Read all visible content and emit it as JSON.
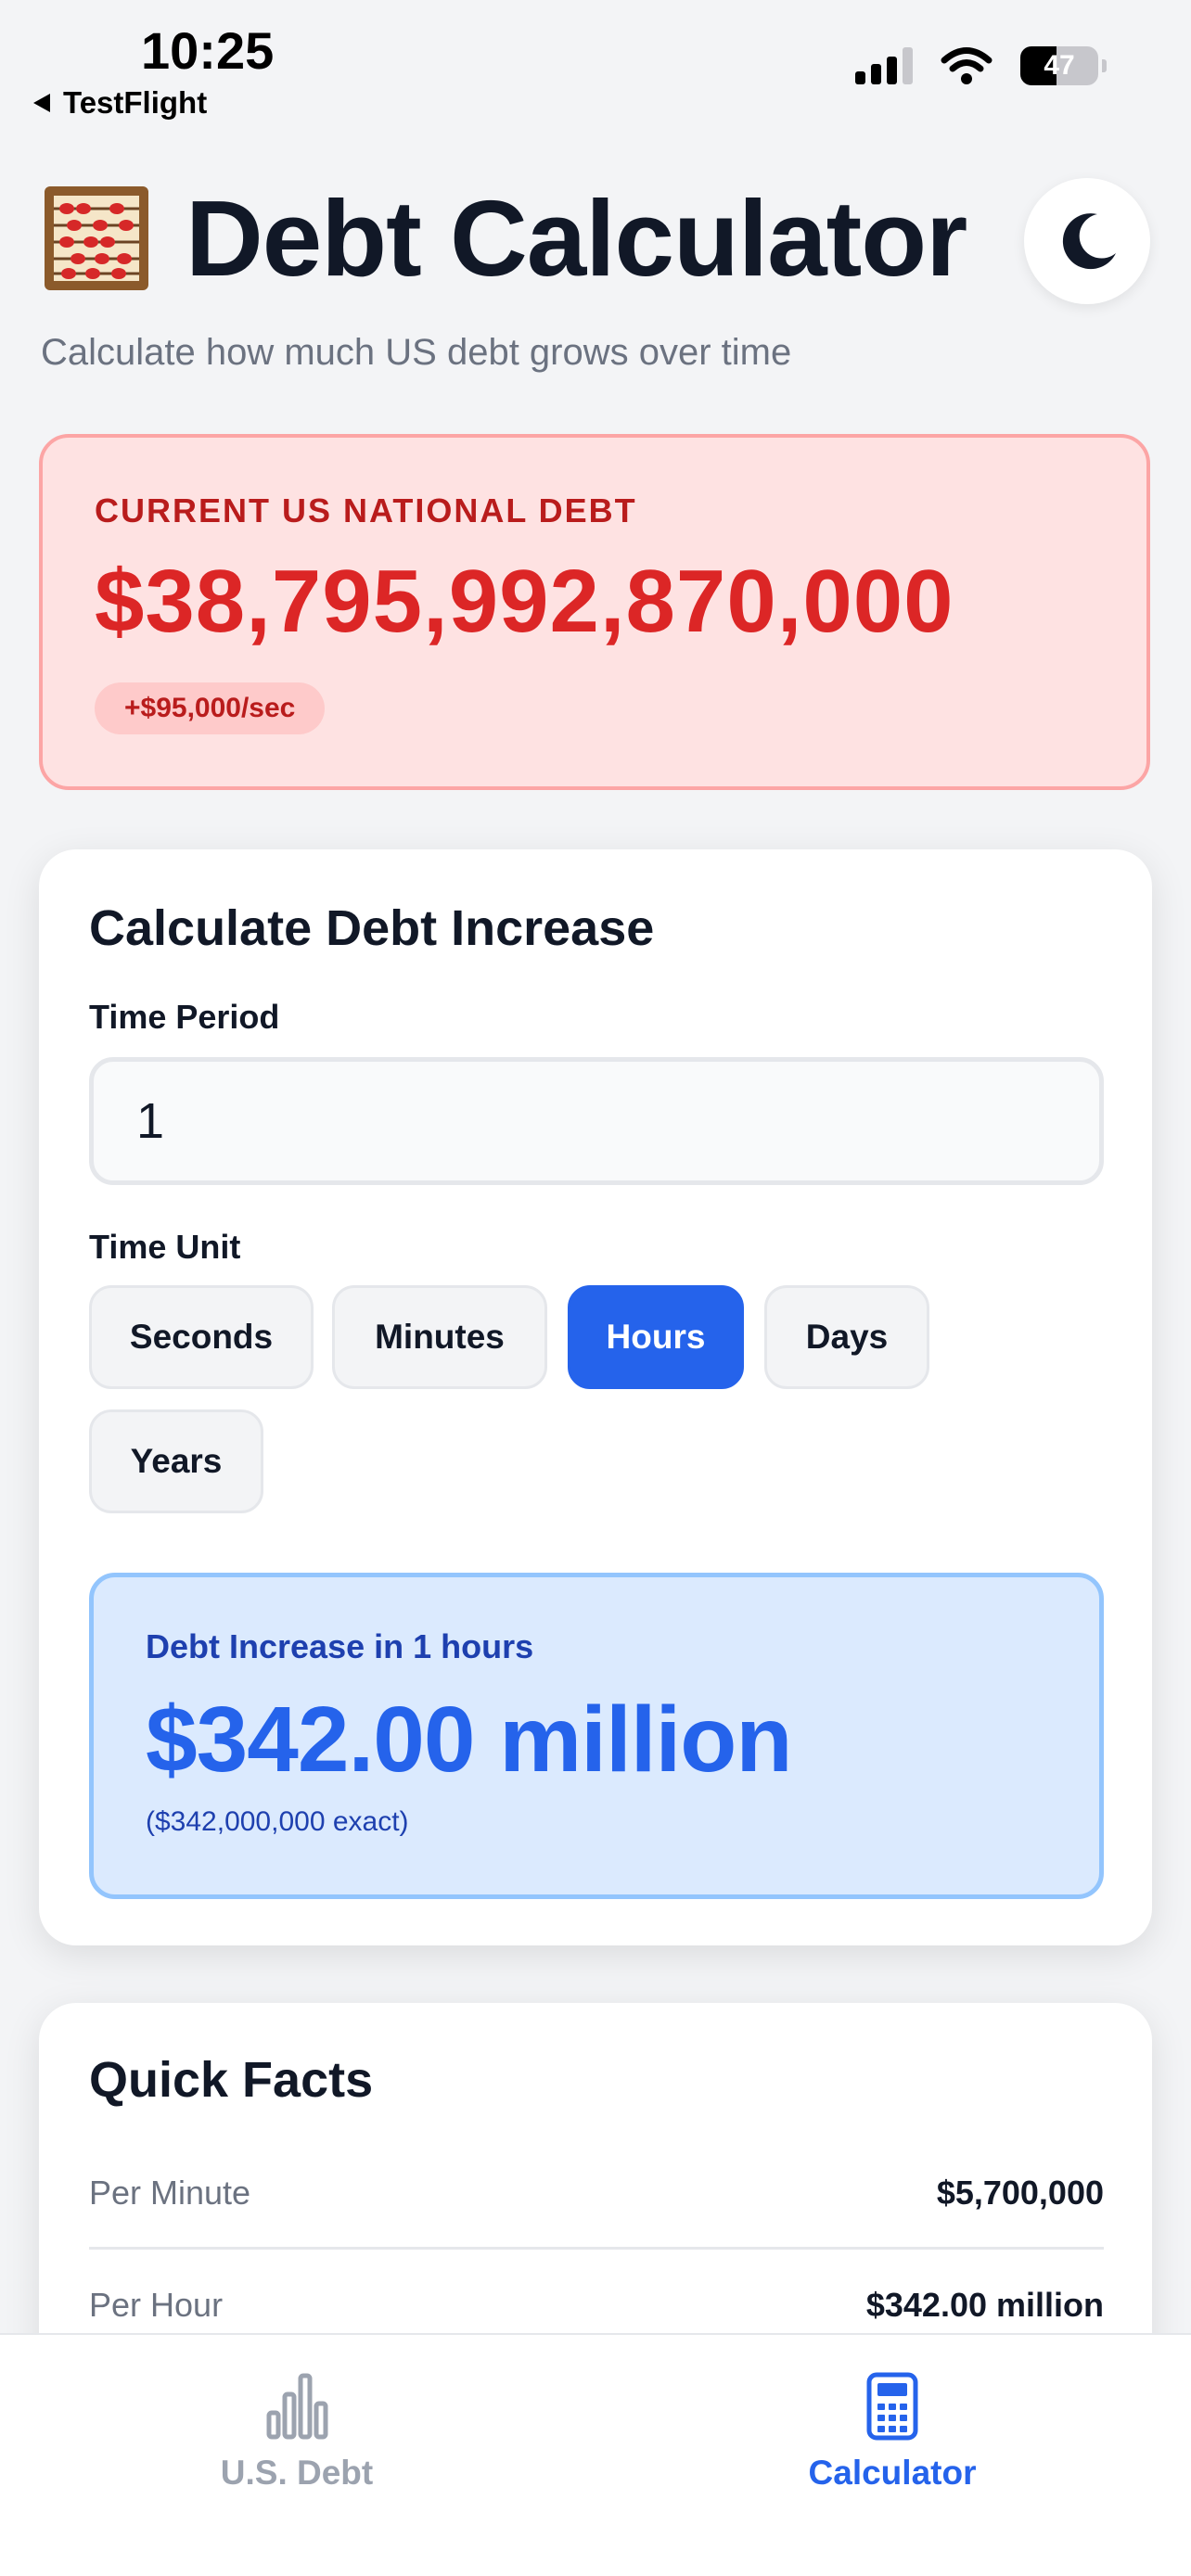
{
  "status_bar": {
    "time": "10:25",
    "back_label": "TestFlight",
    "battery_percent": "47",
    "battery_level": 0.47
  },
  "header": {
    "title": "Debt Calculator",
    "subtitle": "Calculate how much US debt grows over time",
    "title_icon": "abacus-icon",
    "toggle_icon": "moon-icon"
  },
  "debt_card": {
    "label": "CURRENT US NATIONAL DEBT",
    "value": "$38,795,992,870,000",
    "rate": "+$95,000/sec"
  },
  "calculator": {
    "title": "Calculate Debt Increase",
    "time_period_label": "Time Period",
    "time_period_value": "1",
    "time_unit_label": "Time Unit",
    "units": [
      {
        "label": "Seconds",
        "active": false
      },
      {
        "label": "Minutes",
        "active": false
      },
      {
        "label": "Hours",
        "active": true
      },
      {
        "label": "Days",
        "active": false
      },
      {
        "label": "Years",
        "active": false
      }
    ],
    "result_label": "Debt Increase in 1 hours",
    "result_value": "$342.00 million",
    "result_exact": "($342,000,000 exact)"
  },
  "quick_facts": {
    "title": "Quick Facts",
    "rows": [
      {
        "label": "Per Minute",
        "value": "$5,700,000"
      },
      {
        "label": "Per Hour",
        "value": "$342.00 million"
      }
    ]
  },
  "tab_bar": {
    "tabs": [
      {
        "label": "U.S. Debt",
        "icon": "bar-chart-icon",
        "active": false
      },
      {
        "label": "Calculator",
        "icon": "calculator-icon",
        "active": true
      }
    ]
  },
  "colors": {
    "accent": "#2563eb",
    "debt_red": "#dc2626",
    "inactive_tab": "#9ca3af"
  }
}
